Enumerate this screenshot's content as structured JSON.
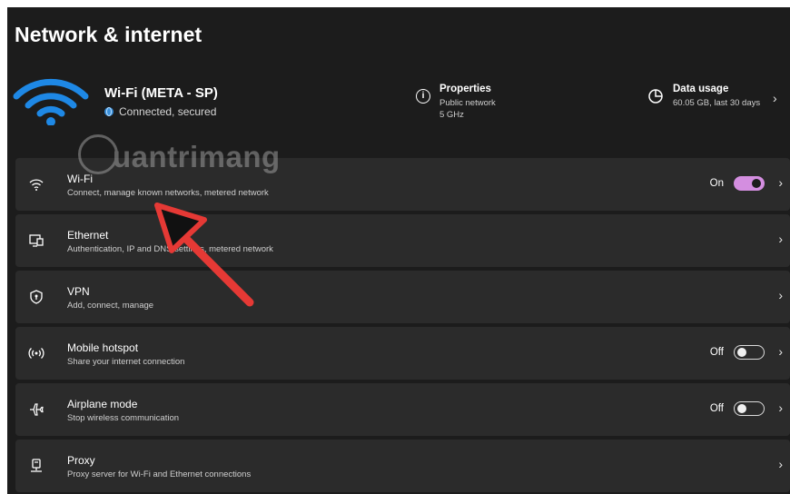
{
  "page": {
    "title": "Network & internet"
  },
  "connection": {
    "name": "Wi-Fi (META - SP)",
    "status": "Connected, secured"
  },
  "properties": {
    "title": "Properties",
    "network_type": "Public network",
    "band": "5 GHz"
  },
  "data_usage": {
    "title": "Data usage",
    "summary": "60.05 GB, last 30 days"
  },
  "watermark": {
    "text": "uantrimang"
  },
  "settings": [
    {
      "title": "Wi-Fi",
      "subtitle": "Connect, manage known networks, metered network",
      "toggle_label": "On",
      "toggle_state": "on",
      "icon": "wifi-icon"
    },
    {
      "title": "Ethernet",
      "subtitle": "Authentication, IP and DNS settings, metered network",
      "icon": "ethernet-icon"
    },
    {
      "title": "VPN",
      "subtitle": "Add, connect, manage",
      "icon": "vpn-shield-icon"
    },
    {
      "title": "Mobile hotspot",
      "subtitle": "Share your internet connection",
      "toggle_label": "Off",
      "toggle_state": "off",
      "icon": "hotspot-icon"
    },
    {
      "title": "Airplane mode",
      "subtitle": "Stop wireless communication",
      "toggle_label": "Off",
      "toggle_state": "off",
      "icon": "airplane-icon"
    },
    {
      "title": "Proxy",
      "subtitle": "Proxy server for Wi-Fi and Ethernet connections",
      "icon": "proxy-icon"
    }
  ],
  "colors": {
    "background": "#1c1c1c",
    "card": "#2b2b2b",
    "accent_wifi": "#1e88e5",
    "toggle_on": "#d48ee0",
    "annotation_arrow": "#e53935"
  }
}
